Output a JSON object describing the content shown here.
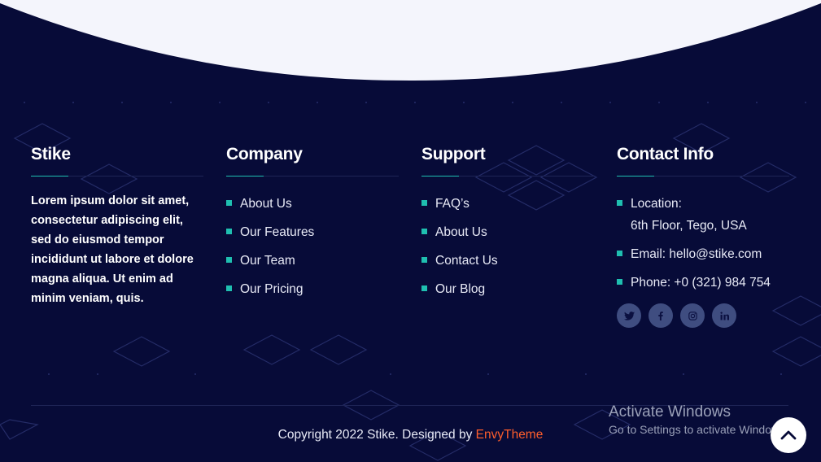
{
  "footer": {
    "about": {
      "title": "Stike",
      "text": "Lorem ipsum dolor sit amet, consectetur adipiscing elit, sed do eiusmod tempor incididunt ut labore et dolore magna aliqua. Ut enim ad minim veniam, quis."
    },
    "company": {
      "title": "Company",
      "links": [
        "About Us",
        "Our Features",
        "Our Team",
        "Our Pricing"
      ]
    },
    "support": {
      "title": "Support",
      "links": [
        "FAQ’s",
        "About Us",
        "Contact Us",
        "Our Blog"
      ]
    },
    "contact": {
      "title": "Contact Info",
      "location_label": "Location:",
      "location_value": "6th Floor, Tego, USA",
      "email": "Email: hello@stike.com",
      "phone": "Phone: +0 (321) 984 754",
      "social": [
        "twitter-icon",
        "facebook-icon",
        "instagram-icon",
        "linkedin-icon"
      ]
    },
    "copyright": {
      "text": "Copyright 2022 Stike. Designed by ",
      "brand": "EnvyTheme"
    }
  },
  "watermark": {
    "line1": "Activate Windows",
    "line2": "Go to Settings to activate Windows."
  },
  "colors": {
    "background": "#070b38",
    "accent": "#1fbfb0",
    "brand_link": "#ff5e2c",
    "social_bg": "#3f4d80"
  }
}
